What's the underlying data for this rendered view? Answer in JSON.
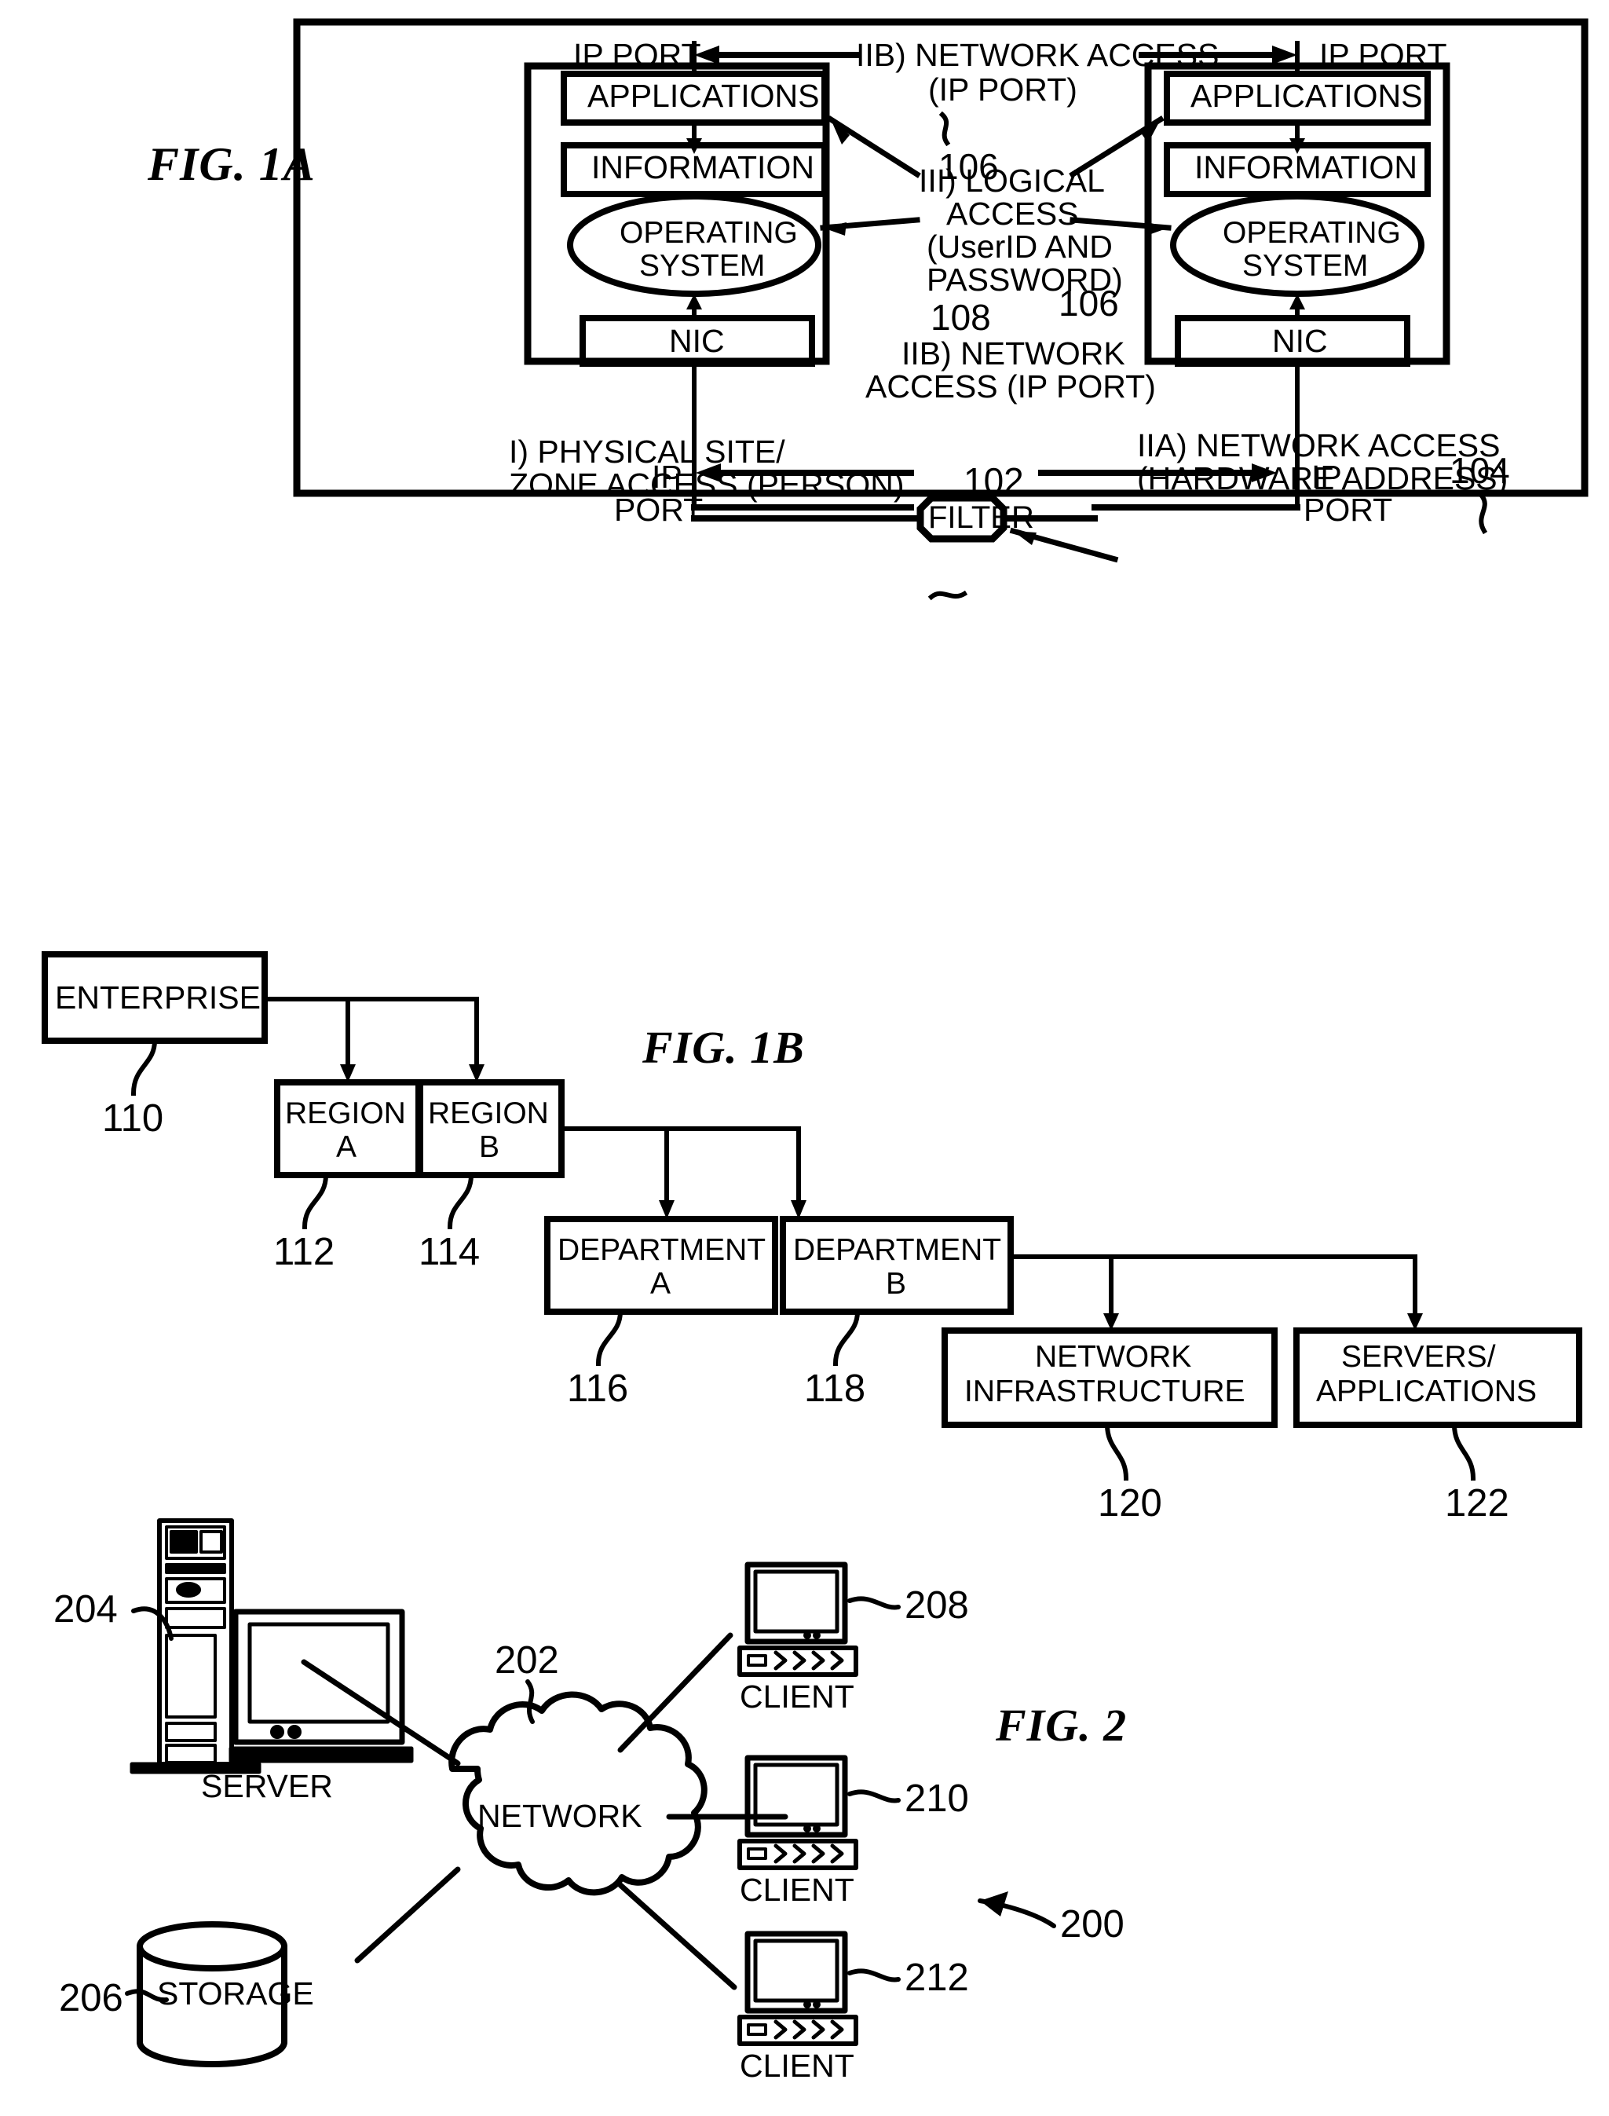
{
  "figures": {
    "fig1a": {
      "title": "FIG. 1A",
      "outer_ref": "104",
      "left_node": {
        "top_port_label": "IP PORT",
        "applications": "APPLICATIONS",
        "information": "INFORMATION",
        "operating_system_line1": "OPERATING",
        "operating_system_line2": "SYSTEM",
        "nic": "NIC",
        "bottom_port_line1": "IP",
        "bottom_port_line2": "PORT"
      },
      "right_node": {
        "top_port_label": "IP PORT",
        "applications": "APPLICATIONS",
        "information": "INFORMATION",
        "operating_system_line1": "OPERATING",
        "operating_system_line2": "SYSTEM",
        "nic": "NIC",
        "bottom_port_line1": "IP",
        "bottom_port_line2": "PORT"
      },
      "center_labels": {
        "network_access_top_line1": "IIB) NETWORK ACCESS",
        "network_access_top_line2": "(IP PORT)",
        "network_access_top_ref": "106",
        "logical_access_line1": "III) LOGICAL",
        "logical_access_line2": "ACCESS",
        "logical_access_line3": "(UserID AND",
        "logical_access_line4": "PASSWORD)",
        "logical_access_ref": "108",
        "network_access_bottom_ref": "106",
        "network_access_bottom_line1": "IIB) NETWORK",
        "network_access_bottom_line2": "ACCESS (IP PORT)"
      },
      "filter": "FILTER",
      "physical_site_line1": "I) PHYSICAL SITE/",
      "physical_site_line2": "ZONE ACCESS (PERSON)",
      "physical_site_ref": "102",
      "hardware_access_line1": "IIA) NETWORK ACCESS",
      "hardware_access_line2": "(HARDWARE ADDRESS)"
    },
    "fig1b": {
      "title": "FIG. 1B",
      "nodes": [
        {
          "label": "ENTERPRISE",
          "label2": "",
          "ref": "110"
        },
        {
          "label": "REGION",
          "label2": "A",
          "ref": "112"
        },
        {
          "label": "REGION",
          "label2": "B",
          "ref": "114"
        },
        {
          "label": "DEPARTMENT",
          "label2": "A",
          "ref": "116"
        },
        {
          "label": "DEPARTMENT",
          "label2": "B",
          "ref": "118"
        },
        {
          "label": "NETWORK",
          "label2": "INFRASTRUCTURE",
          "ref": "120"
        },
        {
          "label": "SERVERS/",
          "label2": "APPLICATIONS",
          "ref": "122"
        }
      ]
    },
    "fig2": {
      "title": "FIG. 2",
      "system_ref": "200",
      "network_label": "NETWORK",
      "network_ref": "202",
      "server_label": "SERVER",
      "server_ref": "204",
      "storage_label": "STORAGE",
      "storage_ref": "206",
      "clients": [
        {
          "label": "CLIENT",
          "ref": "208"
        },
        {
          "label": "CLIENT",
          "ref": "210"
        },
        {
          "label": "CLIENT",
          "ref": "212"
        }
      ]
    }
  }
}
